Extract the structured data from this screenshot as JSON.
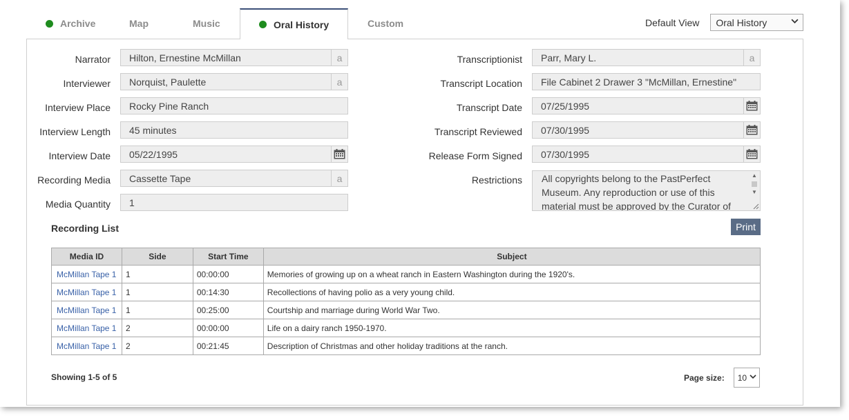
{
  "tabs": [
    {
      "label": "Archive",
      "has_dot": true
    },
    {
      "label": "Map",
      "has_dot": false
    },
    {
      "label": "Music",
      "has_dot": false
    },
    {
      "label": "Oral History",
      "has_dot": true,
      "active": true
    },
    {
      "label": "Custom",
      "has_dot": false
    }
  ],
  "default_view": {
    "label": "Default View",
    "value": "Oral History"
  },
  "left_fields": [
    {
      "label": "Narrator",
      "value": "Hilton, Ernestine McMillan",
      "button": "a"
    },
    {
      "label": "Interviewer",
      "value": "Norquist, Paulette",
      "button": "a"
    },
    {
      "label": "Interview Place",
      "value": "Rocky Pine Ranch",
      "button": ""
    },
    {
      "label": "Interview Length",
      "value": "45 minutes",
      "button": ""
    },
    {
      "label": "Interview Date",
      "value": "05/22/1995",
      "button": "calendar"
    },
    {
      "label": "Recording Media",
      "value": "Cassette Tape",
      "button": "a"
    },
    {
      "label": "Media Quantity",
      "value": "1",
      "button": ""
    }
  ],
  "right_fields": [
    {
      "label": "Transcriptionist",
      "value": "Parr, Mary L.",
      "button": "a"
    },
    {
      "label": "Transcript Location",
      "value": "File Cabinet 2 Drawer 3 \"McMillan, Ernestine\"",
      "button": ""
    },
    {
      "label": "Transcript Date",
      "value": "07/25/1995",
      "button": "calendar"
    },
    {
      "label": "Transcript Reviewed",
      "value": "07/30/1995",
      "button": "calendar"
    },
    {
      "label": "Release Form Signed",
      "value": "07/30/1995",
      "button": "calendar"
    }
  ],
  "restrictions": {
    "label": "Restrictions",
    "value": "All copyrights belong to the PastPerfect Museum. Any reproduction or use of this material must be approved by the Curator of"
  },
  "recording_list": {
    "title": "Recording List",
    "print_label": "Print",
    "columns": [
      "Media ID",
      "Side",
      "Start Time",
      "Subject"
    ],
    "rows": [
      [
        "McMillan Tape 1",
        "1",
        "00:00:00",
        "Memories of growing up on a wheat ranch in Eastern Washington during the 1920's."
      ],
      [
        "McMillan Tape 1",
        "1",
        "00:14:30",
        "Recollections of having polio as a very young child."
      ],
      [
        "McMillan Tape 1",
        "1",
        "00:25:00",
        "Courtship and marriage during World War Two."
      ],
      [
        "McMillan Tape 1",
        "2",
        "00:00:00",
        "Life on a dairy ranch 1950-1970."
      ],
      [
        "McMillan Tape 1",
        "2",
        "00:21:45",
        "Description of Christmas and other holiday traditions at the ranch."
      ]
    ],
    "showing": "Showing 1-5 of 5",
    "page_size_label": "Page size:",
    "page_size_value": "10"
  },
  "colors": {
    "active_tab_border": "#3b4f78",
    "dot_green": "#1e8c1e",
    "link_blue": "#3a62a8",
    "print_button": "#5a6c86"
  }
}
